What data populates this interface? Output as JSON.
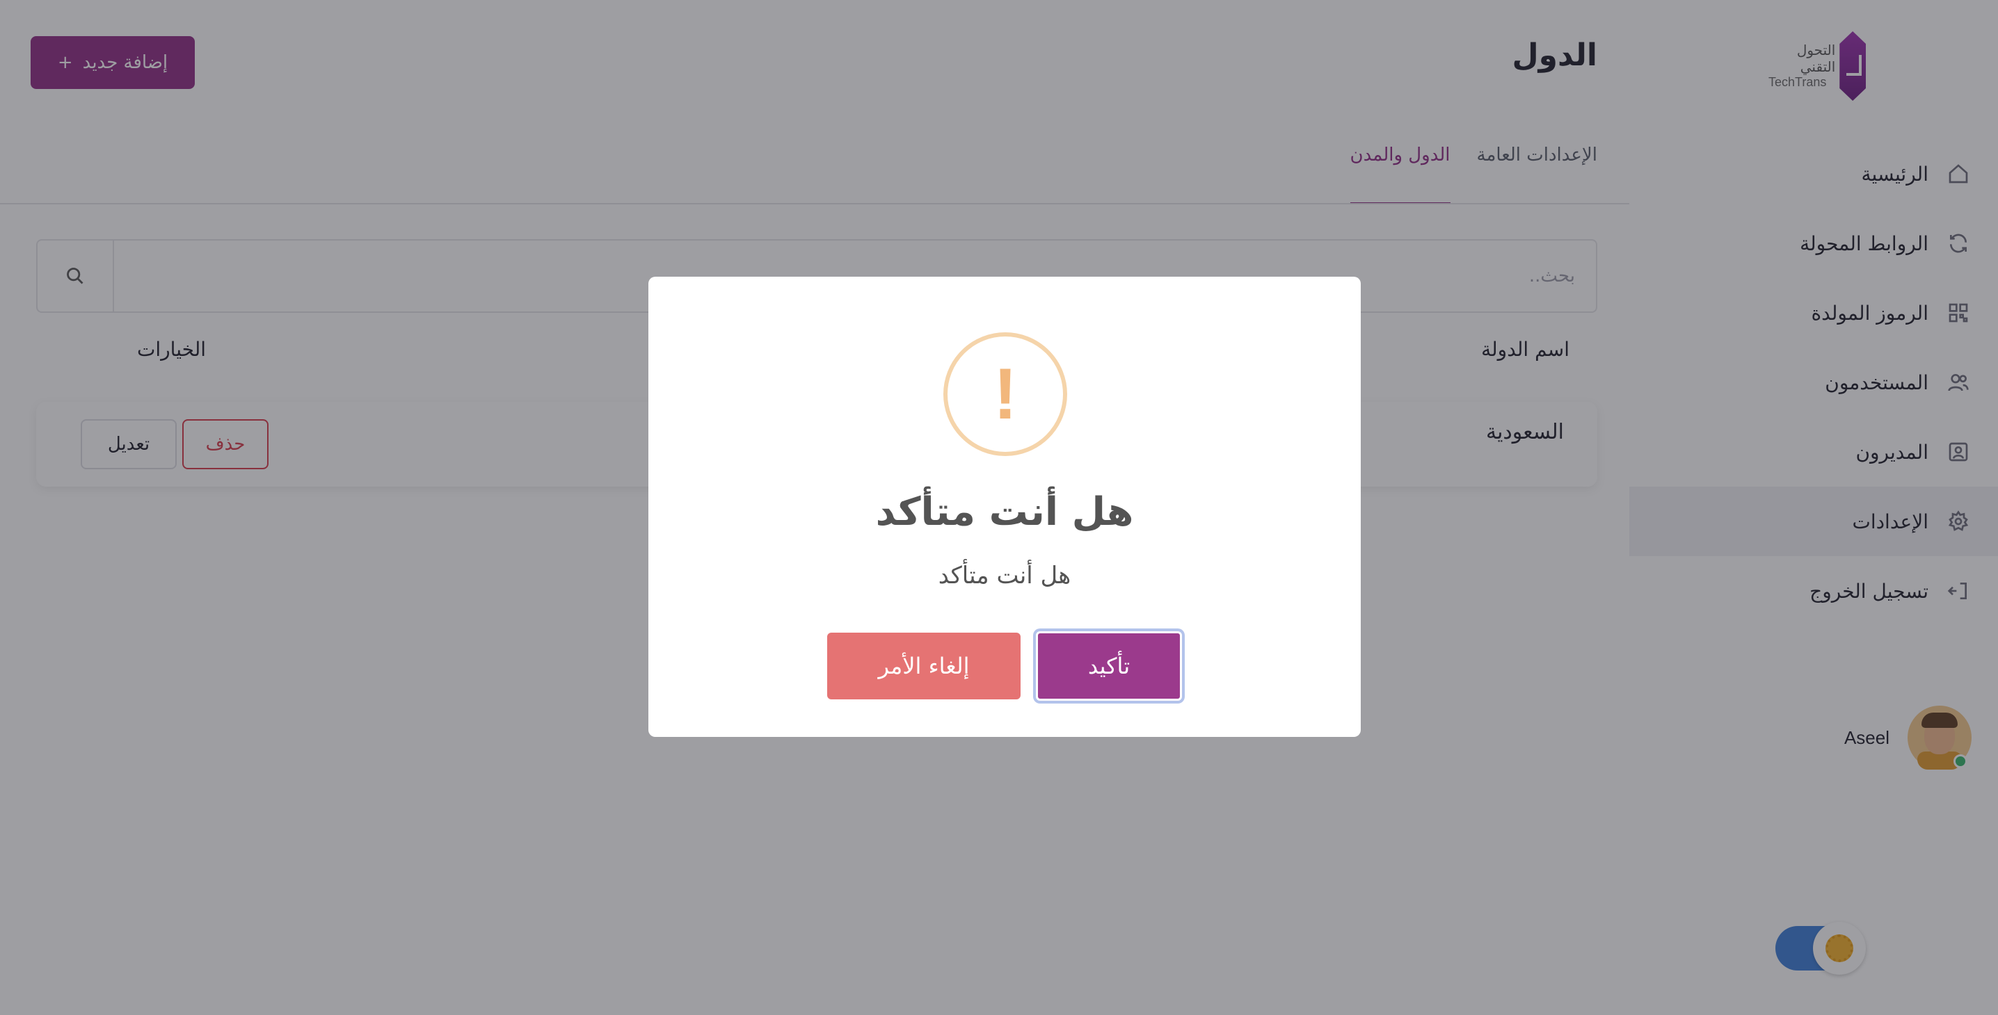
{
  "sidebar": {
    "logo": {
      "text_ar": "التحول التقني",
      "text_en": "TechTrans",
      "color": "#8f2a83"
    },
    "items": [
      {
        "label": "الرئيسية",
        "icon": "home-icon"
      },
      {
        "label": "الروابط المحولة",
        "icon": "refresh-icon"
      },
      {
        "label": "الرموز المولدة",
        "icon": "qr-code-icon"
      },
      {
        "label": "المستخدمون",
        "icon": "users-icon"
      },
      {
        "label": "المديرون",
        "icon": "admin-icon"
      },
      {
        "label": "الإعدادات",
        "icon": "gear-icon",
        "active": true
      },
      {
        "label": "تسجيل الخروج",
        "icon": "logout-icon"
      }
    ],
    "user": {
      "name": "Aseel",
      "status": "online"
    },
    "theme_toggle": {
      "mode": "light"
    }
  },
  "header": {
    "title": "الدول",
    "add_button": {
      "icon": "+",
      "label": "إضافة جديد"
    }
  },
  "tabs": [
    {
      "label": "الإعدادات العامة",
      "active": false
    },
    {
      "label": "الدول والمدن",
      "active": true
    }
  ],
  "search": {
    "placeholder": "بحث.."
  },
  "table": {
    "headers": {
      "name": "اسم الدولة",
      "options": "الخيارات"
    },
    "rows": [
      {
        "name": "السعودية",
        "edit_label": "تعديل",
        "delete_label": "حذف"
      }
    ]
  },
  "modal": {
    "icon": "!",
    "title": "هل أنت متأكد",
    "text": "هل أنت متأكد",
    "confirm_label": "تأكيد",
    "cancel_label": "إلغاء الأمر"
  },
  "colors": {
    "accent": "#8f2a83",
    "confirm": "#9b3a8c",
    "cancel": "#e57373",
    "delete": "#d83a4a",
    "warning": "#f2b77c"
  }
}
